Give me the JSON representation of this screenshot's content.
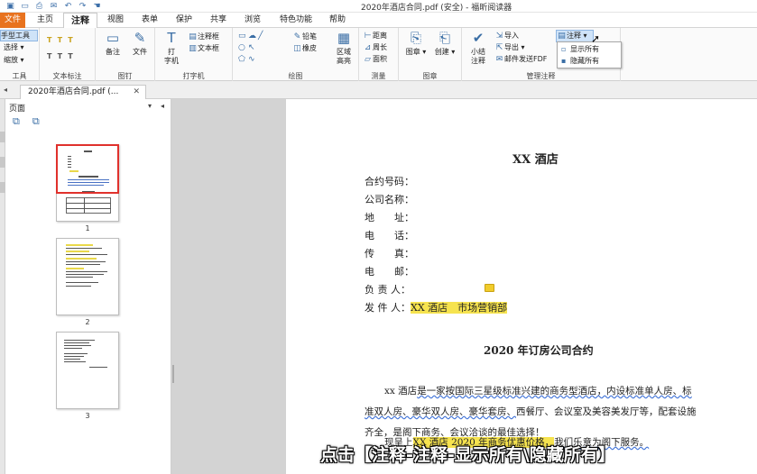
{
  "window": {
    "title": "2020年酒店合同.pdf (安全) - 福昕阅读器"
  },
  "quick_access": [
    "save-icon",
    "open-icon",
    "print-icon",
    "mail-icon",
    "undo-icon",
    "redo-icon",
    "hand-icon"
  ],
  "menu": {
    "file": "文件",
    "tabs": [
      "主页",
      "注释",
      "视图",
      "表单",
      "保护",
      "共享",
      "浏览",
      "特色功能",
      "帮助"
    ]
  },
  "ribbon": {
    "tools": {
      "hand": "手型工具",
      "select": "选择",
      "zoom": "缩放",
      "label": "工具"
    },
    "text_markup": {
      "label": "文本标注"
    },
    "pin": {
      "note": "备注",
      "file": "文件",
      "label": "图钉"
    },
    "typewriter": {
      "type": "打\n字机",
      "comment_box": "注释框",
      "text_box": "文本框",
      "label": "打字机"
    },
    "drawing": {
      "pencil": "铅笔",
      "eraser": "橡皮",
      "area_highlight": "区域\n高亮",
      "label": "绘图"
    },
    "measure": {
      "distance": "距离",
      "perimeter": "周长",
      "area": "面积",
      "label": "测量"
    },
    "stamp": {
      "stamp": "图章",
      "create": "创建",
      "label": "图章"
    },
    "manage": {
      "summary": "小结\n注释",
      "import": "导入",
      "export": "导出",
      "email_fdf": "邮件发送FDF",
      "annotate": "注释",
      "label": "管理注释"
    }
  },
  "annot_menu": {
    "show_all": "显示所有",
    "hide_all": "隐藏所有"
  },
  "doc_tab": {
    "name": "2020年酒店合同.pdf (..."
  },
  "thumb_panel": {
    "title": "页面",
    "pages": [
      "1",
      "2",
      "3"
    ]
  },
  "document": {
    "title": "XX 酒店",
    "fields": [
      {
        "label": "合约号码：",
        "value": ""
      },
      {
        "label": "公司名称：",
        "value": ""
      },
      {
        "label": "地　　址：",
        "value": ""
      },
      {
        "label": "电　　话：",
        "value": ""
      },
      {
        "label": "传　　真：",
        "value": ""
      },
      {
        "label": "电　　邮：",
        "value": ""
      },
      {
        "label": "负 责 人：",
        "value": ""
      },
      {
        "label": "发 件 人：",
        "value": "XX 酒店　市场营销部"
      }
    ],
    "subtitle": "2020 年订房公司合约",
    "para1_l1a": "xx 酒店",
    "para1_l1b": "是一家按国际三星级标准兴建的商务型酒店，内设标准单人房、标",
    "para1_l2": "准双人房、豪华双人房、豪华套房、",
    "para1_l2b": "西餐厅、会议室及美容美发厅等，配套设施",
    "para1_l3": "齐全，是阁下商务、会议洽谈的最佳选择！",
    "para2_a": "现呈上",
    "para2_b": "XX 酒店 2020 年商务优惠价格，",
    "para2_c": "我们乐意为阁下服务。"
  },
  "caption": "点击【注释-注释-显示所有\\隐藏所有】",
  "colors": {
    "file_tab": "#e8731f",
    "highlight": "#f6e34f",
    "selection": "#e0312c",
    "accent": "#3a6ea5"
  }
}
